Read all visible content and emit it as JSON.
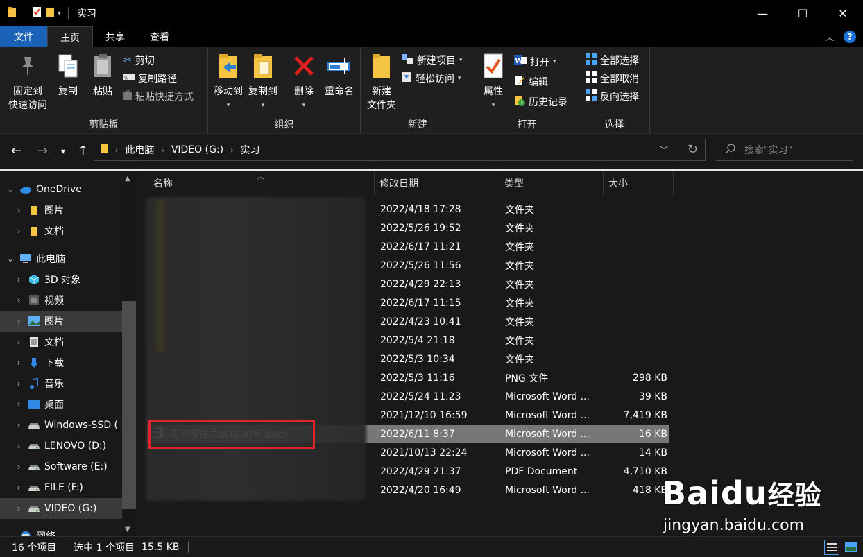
{
  "window": {
    "title": "实习",
    "minimize": "—",
    "maximize": "☐",
    "close": "✕"
  },
  "ribbon_tabs": {
    "file": "文件",
    "home": "主页",
    "share": "共享",
    "view": "查看"
  },
  "ribbon": {
    "clipboard": {
      "label": "剪贴板",
      "pin_line1": "固定到",
      "pin_line2": "快速访问",
      "copy": "复制",
      "paste": "粘贴",
      "cut": "剪切",
      "copy_path": "复制路径",
      "paste_shortcut": "粘贴快捷方式"
    },
    "organize": {
      "label": "组织",
      "move_to": "移动到",
      "copy_to": "复制到",
      "delete": "删除",
      "rename": "重命名"
    },
    "new": {
      "label": "新建",
      "new_folder_line1": "新建",
      "new_folder_line2": "文件夹",
      "new_item": "新建项目",
      "easy_access": "轻松访问"
    },
    "open": {
      "label": "打开",
      "properties": "属性",
      "open": "打开",
      "edit": "编辑",
      "history": "历史记录"
    },
    "select": {
      "label": "选择",
      "select_all": "全部选择",
      "select_none": "全部取消",
      "invert": "反向选择"
    }
  },
  "address": {
    "crumbs": [
      "此电脑",
      "VIDEO (G:)",
      "实习"
    ],
    "search_placeholder": "搜索\"实习\""
  },
  "nav": [
    {
      "label": "OneDrive",
      "icon": "cloud-icon",
      "indent": 0
    },
    {
      "label": "图片",
      "icon": "folder-icon",
      "indent": 1
    },
    {
      "label": "文档",
      "icon": "folder-icon",
      "indent": 1
    },
    {
      "label": "此电脑",
      "icon": "computer-icon",
      "indent": 0
    },
    {
      "label": "3D 对象",
      "icon": "cube-icon",
      "indent": 1
    },
    {
      "label": "视频",
      "icon": "video-icon",
      "indent": 1
    },
    {
      "label": "图片",
      "icon": "picture-icon",
      "indent": 1
    },
    {
      "label": "文档",
      "icon": "document-icon",
      "indent": 1
    },
    {
      "label": "下载",
      "icon": "download-icon",
      "indent": 1
    },
    {
      "label": "音乐",
      "icon": "music-icon",
      "indent": 1
    },
    {
      "label": "桌面",
      "icon": "desktop-icon",
      "indent": 1
    },
    {
      "label": "Windows-SSD (",
      "icon": "drive-icon",
      "indent": 1
    },
    {
      "label": "LENOVO (D:)",
      "icon": "drive-icon",
      "indent": 1
    },
    {
      "label": "Software (E:)",
      "icon": "drive-icon",
      "indent": 1
    },
    {
      "label": "FILE (F:)",
      "icon": "drive-icon",
      "indent": 1
    },
    {
      "label": "VIDEO (G:)",
      "icon": "drive-icon",
      "indent": 1
    },
    {
      "label": "网络",
      "icon": "network-icon",
      "indent": 0
    }
  ],
  "columns": {
    "name": "名称",
    "date": "修改日期",
    "type": "类型",
    "size": "大小"
  },
  "files": [
    {
      "name": "",
      "date": "2022/4/18 17:28",
      "type": "文件夹",
      "size": ""
    },
    {
      "name": "",
      "date": "2022/5/26 19:52",
      "type": "文件夹",
      "size": ""
    },
    {
      "name": "",
      "date": "2022/6/17 11:21",
      "type": "文件夹",
      "size": ""
    },
    {
      "name": "",
      "date": "2022/5/26 11:56",
      "type": "文件夹",
      "size": ""
    },
    {
      "name": "",
      "date": "2022/4/29 22:13",
      "type": "文件夹",
      "size": ""
    },
    {
      "name": "",
      "date": "2022/6/17 11:15",
      "type": "文件夹",
      "size": ""
    },
    {
      "name": "",
      "date": "2022/4/23 10:41",
      "type": "文件夹",
      "size": ""
    },
    {
      "name": "",
      "date": "2022/5/4 21:18",
      "type": "文件夹",
      "size": ""
    },
    {
      "name": "",
      "date": "2022/5/3 10:34",
      "type": "文件夹",
      "size": ""
    },
    {
      "name": "",
      "date": "2022/5/3 11:16",
      "type": "PNG 文件",
      "size": "298 KB"
    },
    {
      "name": "",
      "date": "2022/5/24 11:23",
      "type": "Microsoft Word ...",
      "size": "39 KB"
    },
    {
      "name": "",
      "date": "2021/12/10 16:59",
      "type": "Microsoft Word ...",
      "size": "7,419 KB"
    },
    {
      "name": "实习报告总结1000字.docx",
      "date": "2022/6/11 8:37",
      "type": "Microsoft Word ...",
      "size": "16 KB",
      "selected": true
    },
    {
      "name": "",
      "date": "2021/10/13 22:24",
      "type": "Microsoft Word ...",
      "size": "14 KB"
    },
    {
      "name": "",
      "date": "2022/4/29 21:37",
      "type": "PDF Document",
      "size": "4,710 KB"
    },
    {
      "name": "",
      "date": "2022/4/20 16:49",
      "type": "Microsoft Word ...",
      "size": "418 KB"
    }
  ],
  "status": {
    "count": "16 个项目",
    "selected": "选中 1 个项目",
    "size": "15.5 KB"
  },
  "watermark": {
    "logo_a": "Bai",
    "logo_b": "du",
    "logo_c": "经验",
    "url": "jingyan.baidu.com"
  },
  "colors": {
    "accent": "#1a62b8",
    "folder": "#f5c542",
    "selection_row": "#777777",
    "highlight_box": "#e0242b"
  }
}
